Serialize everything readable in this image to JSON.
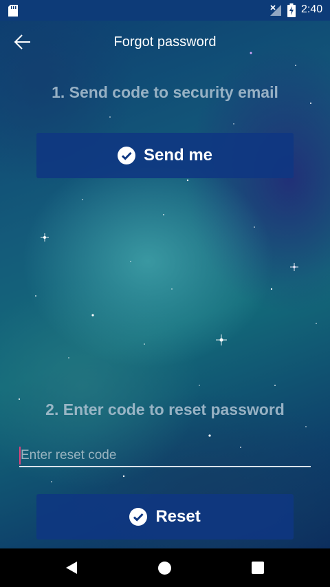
{
  "status_bar": {
    "time": "2:40",
    "icons": [
      "sd-card-icon",
      "no-signal-icon",
      "battery-charging-icon"
    ]
  },
  "app_bar": {
    "title": "Forgot password",
    "back_icon": "arrow-left-icon"
  },
  "step1": {
    "heading": "1. Send code to security email",
    "button_label": "Send me",
    "button_icon": "check-circle-icon"
  },
  "step2": {
    "heading": "2. Enter code to reset password",
    "input_value": "",
    "input_placeholder": "Enter reset code",
    "button_label": "Reset",
    "button_icon": "check-circle-icon"
  },
  "nav_bar": {
    "icons": [
      "nav-back-icon",
      "nav-home-icon",
      "nav-recents-icon"
    ]
  },
  "colors": {
    "status_bar": "#0d3b78",
    "button": "#0f3782",
    "heading_text": "#afc3d2",
    "accent_caret": "#e0427a",
    "nav_bar": "#000000"
  }
}
